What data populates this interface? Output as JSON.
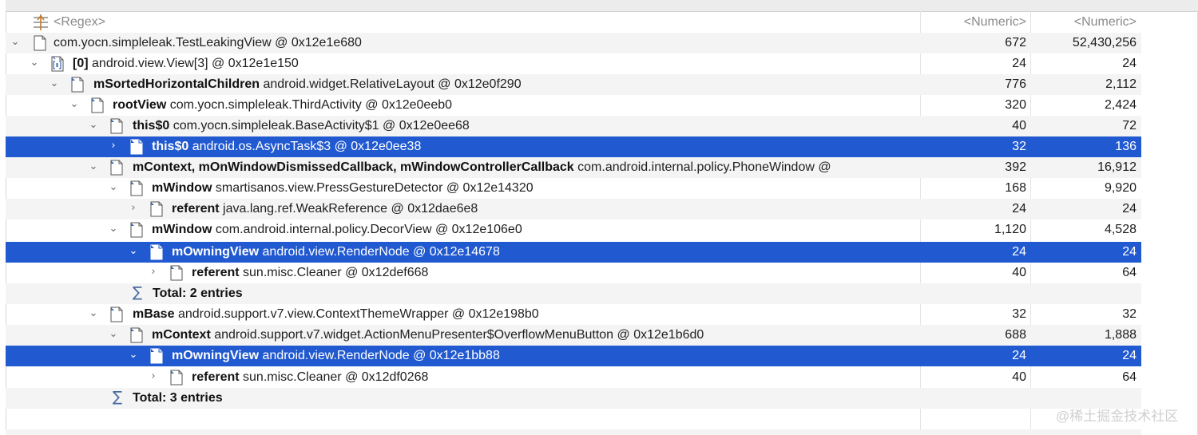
{
  "filter_row": {
    "name_placeholder": "<Regex>",
    "shallow_placeholder": "<Numeric>",
    "retained_placeholder": "<Numeric>"
  },
  "rows": [
    {
      "field": "",
      "cls": "com.yocn.simpleleak.TestLeakingView @ 0x12e1e680",
      "shallow": "672",
      "retained": "52,430,256"
    },
    {
      "field": "[0]",
      "cls": "android.view.View[3] @ 0x12e1e150",
      "shallow": "24",
      "retained": "24"
    },
    {
      "field": "mSortedHorizontalChildren",
      "cls": "android.widget.RelativeLayout @ 0x12e0f290",
      "shallow": "776",
      "retained": "2,112"
    },
    {
      "field": "rootView",
      "cls": "com.yocn.simpleleak.ThirdActivity @ 0x12e0eeb0",
      "shallow": "320",
      "retained": "2,424"
    },
    {
      "field": "this$0",
      "cls": "com.yocn.simpleleak.BaseActivity$1 @ 0x12e0ee68",
      "shallow": "40",
      "retained": "72"
    },
    {
      "field": "this$0",
      "cls": "android.os.AsyncTask$3 @ 0x12e0ee38",
      "shallow": "32",
      "retained": "136"
    },
    {
      "field": "mContext, mOnWindowDismissedCallback, mWindowControllerCallback",
      "cls": "com.android.internal.policy.PhoneWindow @",
      "shallow": "392",
      "retained": "16,912"
    },
    {
      "field": "mWindow",
      "cls": "smartisanos.view.PressGestureDetector @ 0x12e14320",
      "shallow": "168",
      "retained": "9,920"
    },
    {
      "field": "referent",
      "cls": "java.lang.ref.WeakReference @ 0x12dae6e8",
      "shallow": "24",
      "retained": "24"
    },
    {
      "field": "mWindow",
      "cls": "com.android.internal.policy.DecorView @ 0x12e106e0",
      "shallow": "1,120",
      "retained": "4,528"
    },
    {
      "field": "mOwningView",
      "cls": "android.view.RenderNode @ 0x12e14678",
      "shallow": "24",
      "retained": "24"
    },
    {
      "field": "referent",
      "cls": "sun.misc.Cleaner @ 0x12def668",
      "shallow": "40",
      "retained": "64"
    },
    {
      "field": "Total: 2 entries",
      "cls": "",
      "shallow": "",
      "retained": ""
    },
    {
      "field": "mBase",
      "cls": "android.support.v7.view.ContextThemeWrapper @ 0x12e198b0",
      "shallow": "32",
      "retained": "32"
    },
    {
      "field": "mContext",
      "cls": "android.support.v7.widget.ActionMenuPresenter$OverflowMenuButton @ 0x12e1b6d0",
      "shallow": "688",
      "retained": "1,888"
    },
    {
      "field": "mOwningView",
      "cls": "android.view.RenderNode @ 0x12e1bb88",
      "shallow": "24",
      "retained": "24"
    },
    {
      "field": "referent",
      "cls": "sun.misc.Cleaner @ 0x12df0268",
      "shallow": "40",
      "retained": "64"
    },
    {
      "field": "Total: 3 entries",
      "cls": "",
      "shallow": "",
      "retained": ""
    }
  ],
  "icons": {
    "filter": "regex-filter-icon",
    "object": "object-file-icon",
    "array": "object-array-icon",
    "total": "sigma-sum-icon",
    "expanded": "chevron-down-icon",
    "collapsed": "chevron-right-icon"
  },
  "colors": {
    "selection": "#2159d0",
    "alt_row": "#f4f4f4"
  },
  "watermark": "@稀土掘金技术社区"
}
